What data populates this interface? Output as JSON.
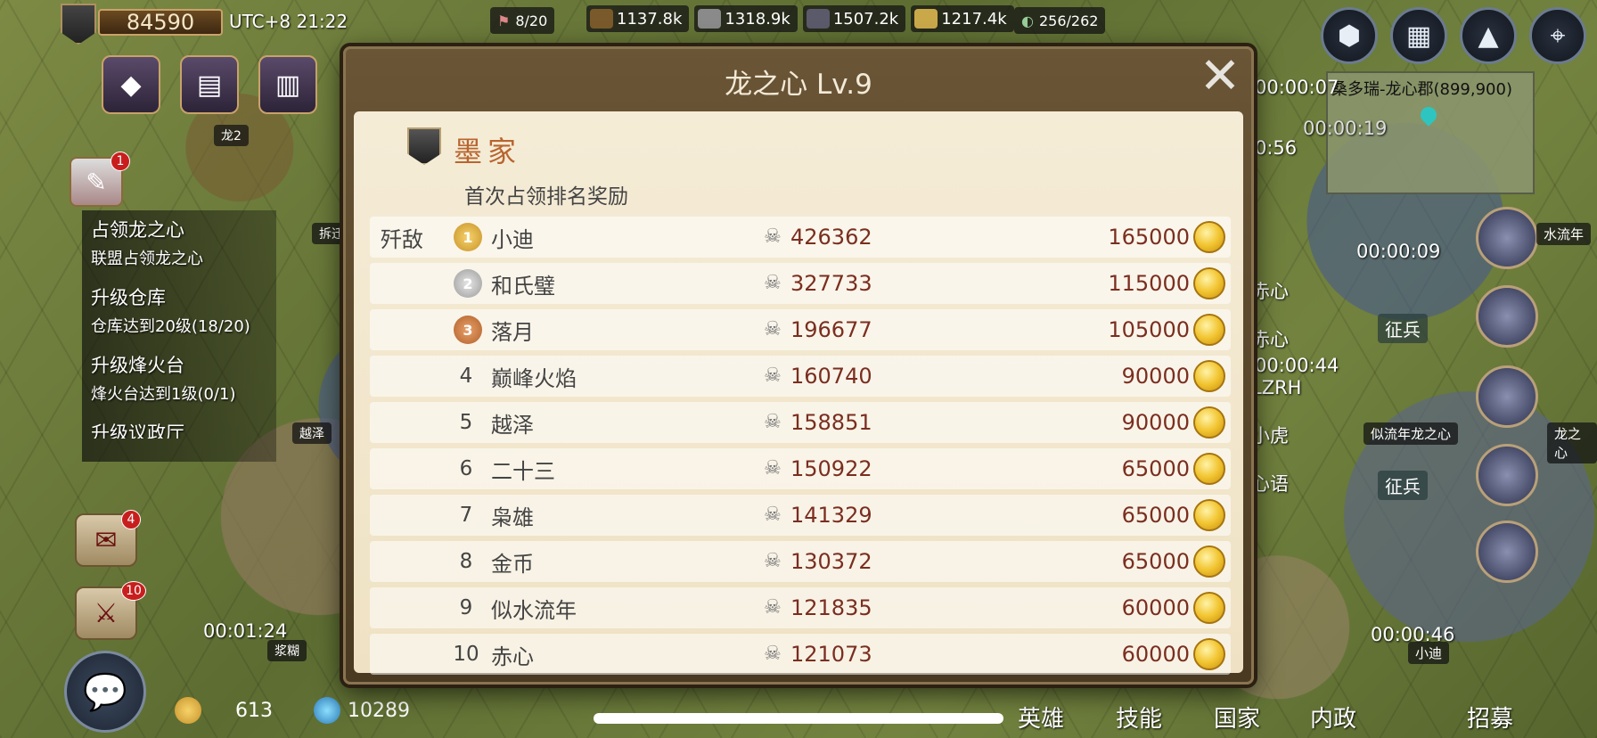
{
  "header": {
    "power": "84590",
    "clock": "UTC+8 21:22",
    "troops": "8/20",
    "resources": [
      {
        "value": "1137.8k",
        "icon": "wood-icon",
        "color": "#7a5a2a"
      },
      {
        "value": "1318.9k",
        "icon": "stone-icon",
        "color": "#8a8a8a"
      },
      {
        "value": "1507.2k",
        "icon": "iron-icon",
        "color": "#5a5a6a"
      },
      {
        "value": "1217.4k",
        "icon": "grain-icon",
        "color": "#c9a84a"
      }
    ],
    "march": "256/262"
  },
  "left_panel": {
    "quests": [
      {
        "title": "占领龙之心",
        "sub": "联盟占领龙之心"
      },
      {
        "title": "升级仓库",
        "sub": "仓库达到20级(18/20)"
      },
      {
        "title": "升级烽火台",
        "sub": "烽火台达到1级(0/1)"
      },
      {
        "title": "升级议政厅",
        "sub": ""
      }
    ],
    "quest_badge": "1",
    "mail_badge": "4",
    "battle_badge": "10",
    "timer": "00:01:24",
    "map_labels": [
      "龙2",
      "拆迁",
      "越泽",
      "浆糊"
    ]
  },
  "bottom": {
    "gold": "613",
    "gems": "10289",
    "nav": [
      "英雄",
      "技能",
      "国家",
      "内政",
      "招募"
    ]
  },
  "right_panel": {
    "minimap_label": "桑多瑞-龙心郡(899,900)",
    "timers": [
      "00:00:07",
      "00:00:19",
      "0:56",
      "00:00:09",
      "00:00:44",
      "00:00:46"
    ],
    "names": [
      "赤心",
      "赤心",
      "LZRH",
      "小虎",
      "心语"
    ],
    "tags": [
      "水流年",
      "似流年龙之心",
      "龙之心",
      "小迪"
    ],
    "buttons": [
      "征兵",
      "征兵"
    ]
  },
  "modal": {
    "title": "龙之心 Lv.9",
    "alliance": "墨家",
    "subtitle": "首次占领排名奖励",
    "row_label": "歼敌",
    "rows": [
      {
        "rank": "1",
        "name": "小迪",
        "kills": "426362",
        "reward": "165000"
      },
      {
        "rank": "2",
        "name": "和氏璧",
        "kills": "327733",
        "reward": "115000"
      },
      {
        "rank": "3",
        "name": "落月",
        "kills": "196677",
        "reward": "105000"
      },
      {
        "rank": "4",
        "name": "巅峰火焰",
        "kills": "160740",
        "reward": "90000"
      },
      {
        "rank": "5",
        "name": "越泽",
        "kills": "158851",
        "reward": "90000"
      },
      {
        "rank": "6",
        "name": "二十三",
        "kills": "150922",
        "reward": "65000"
      },
      {
        "rank": "7",
        "name": "枭雄",
        "kills": "141329",
        "reward": "65000"
      },
      {
        "rank": "8",
        "name": "金币",
        "kills": "130372",
        "reward": "65000"
      },
      {
        "rank": "9",
        "name": "似水流年",
        "kills": "121835",
        "reward": "60000"
      },
      {
        "rank": "10",
        "name": "赤心",
        "kills": "121073",
        "reward": "60000"
      }
    ]
  }
}
